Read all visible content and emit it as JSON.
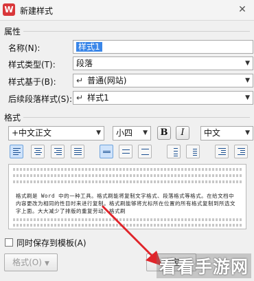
{
  "window": {
    "title": "新建样式",
    "app_icon": "W",
    "close_symbol": "✕"
  },
  "properties": {
    "section_title": "属性",
    "name_label": "名称(N):",
    "name_value": "样式1",
    "type_label": "样式类型(T):",
    "type_value": "段落",
    "based_on_label": "样式基于(B):",
    "based_on_value": "普通(网站)",
    "next_label": "后续段落样式(S):",
    "next_value": "样式1"
  },
  "format": {
    "section_title": "格式",
    "font_value": "+中文正文",
    "size_value": "小四",
    "bold_label": "B",
    "italic_label": "I",
    "lang_value": "中文"
  },
  "preview": {
    "sample_text": "格式刷是 Word 中的一种工具。格式刷能将复制文字格式、段落格式等格式。在给文档中内容更改为相同的性目时来进行复制。格式刷能够将光标所在位置的所有格式复制到所选文字上面。大大减少了排版的重复劳动。格式刷"
  },
  "save_template": {
    "label": "同时保存到模板(A)"
  },
  "buttons": {
    "format_label": "格式(O)",
    "ok_label": "确定"
  },
  "watermark": {
    "text": "看看手游网"
  },
  "colors": {
    "selection": "#3a86e8",
    "active_toggle": "#cfe3fb",
    "annotation_arrow": "#e0242a"
  }
}
